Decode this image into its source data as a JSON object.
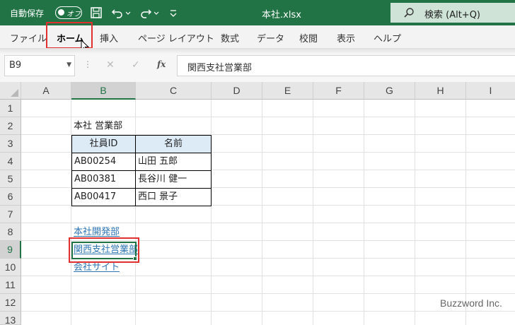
{
  "titlebar": {
    "autosave_label": "自動保存",
    "autosave_state": "オフ",
    "doc_title": "本社.xlsx",
    "search_text": "検索 (Alt+Q)",
    "accent": "#217346"
  },
  "ribbon": {
    "tabs": [
      {
        "label": "ファイル"
      },
      {
        "label": "ホーム",
        "active": true
      },
      {
        "label": "挿入"
      },
      {
        "label": "ページ レイアウト"
      },
      {
        "label": "数式"
      },
      {
        "label": "データ"
      },
      {
        "label": "校閲"
      },
      {
        "label": "表示"
      },
      {
        "label": "ヘルプ"
      }
    ]
  },
  "formula_bar": {
    "name_box": "B9",
    "formula": "関西支社営業部"
  },
  "sheet": {
    "columns": [
      "A",
      "B",
      "C",
      "D",
      "E",
      "F",
      "G",
      "H",
      "I"
    ],
    "rows": [
      "1",
      "2",
      "3",
      "4",
      "5",
      "6",
      "7",
      "8",
      "9",
      "10",
      "11",
      "12",
      "13"
    ],
    "selected_column": "B",
    "selected_row": "9",
    "cells": {
      "B2": "本社 営業部",
      "B8": "本社開発部",
      "B9": "関西支社営業部",
      "B10": "会社サイト"
    },
    "table": {
      "headers": [
        "社員ID",
        "名前"
      ],
      "rows": [
        [
          "AB00254",
          "山田 五郎"
        ],
        [
          "AB00381",
          "長谷川 健一"
        ],
        [
          "AB00417",
          "西口 景子"
        ]
      ],
      "header_fill": "#ddebf7"
    },
    "link_color": "#2e75b6"
  },
  "watermark": "Buzzword Inc."
}
